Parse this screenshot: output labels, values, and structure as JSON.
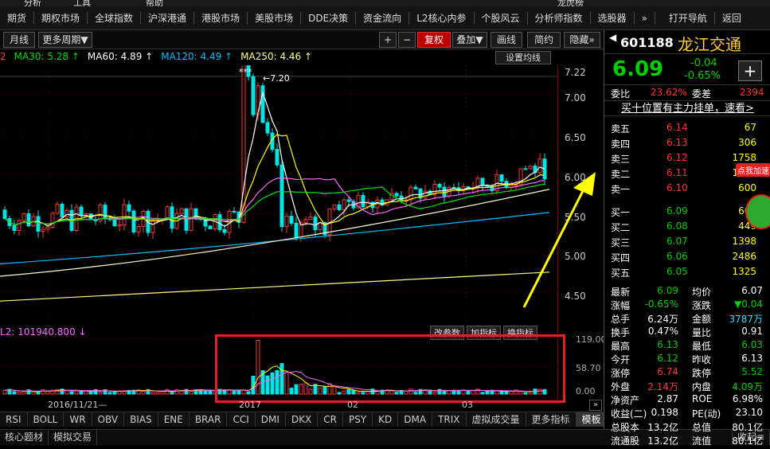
{
  "topbar": [
    "分析",
    "工具",
    "帮助",
    "龙虎榜"
  ],
  "menu": [
    "期货",
    "期权市场",
    "全球指数",
    "沪深港通",
    "港股市场",
    "美股市场",
    "DDE决策",
    "资金流向",
    "L2核心内参",
    "个股风云",
    "分析师指数",
    "选股器",
    "»",
    "打开导航",
    "返回"
  ],
  "toolbar": {
    "period_day": "月线",
    "more_period": "更多周期▼",
    "plus": "+",
    "minus": "−",
    "fuquan": "复权",
    "add": "叠加▼",
    "draw": "画线",
    "brief": "简约",
    "hide": "隐藏»",
    "set_ma": "设置均线"
  },
  "ma_legend": [
    {
      "text": "2",
      "color": "#ff3232"
    },
    {
      "text": "MA30: 5.28 ↑",
      "color": "#00e000"
    },
    {
      "text": "MA60: 4.89 ↑",
      "color": "#ffffff"
    },
    {
      "text": "MA120: 4.49 ↑",
      "color": "#00bfff"
    },
    {
      "text": "MA250: 4.46 ↑",
      "color": "#ffff80"
    }
  ],
  "price_axis": [
    "7.22",
    "7.00",
    "6.50",
    "6.00",
    "5.50",
    "5.00",
    "4.50"
  ],
  "peak_label": "7.20",
  "stars": "***",
  "vol_legend": "L2: 101940.800 ↓",
  "vol_axis": [
    "119.00",
    "58.70",
    "0.00"
  ],
  "vol_buttons": [
    "改参数",
    "加指标",
    "换指标"
  ],
  "dates": {
    "d1": "2016/11/21—",
    "d2": "2017",
    "d3": "02",
    "d4": "03"
  },
  "indicators": [
    "RSI",
    "BOLL",
    "WR",
    "OBV",
    "BIAS",
    "ENE",
    "BRAR",
    "CCI",
    "DMI",
    "DKX",
    "CR",
    "PSY",
    "KD",
    "DMA",
    "TRIX",
    "虚拟成交量",
    "更多指标",
    "模板"
  ],
  "bottom": [
    "核心题材",
    "模拟交易",
    "收起≡"
  ],
  "promo": "点我加速",
  "stock": {
    "code": "601188",
    "name": "龙江交通",
    "price": "6.09",
    "change": "-0.04",
    "change_pct": "-0.65%",
    "add_btn": "+",
    "weibi_label": "委比",
    "weibi": "23.62%",
    "weicha_label": "委差",
    "weicha": "2394",
    "banner": "买十位置有主力挂单，速看>"
  },
  "sell": [
    {
      "label": "卖五",
      "price": "6.14",
      "vol": "67"
    },
    {
      "label": "卖四",
      "price": "6.13",
      "vol": "306"
    },
    {
      "label": "卖三",
      "price": "6.12",
      "vol": "1758"
    },
    {
      "label": "卖二",
      "price": "6.11",
      "vol": "1138"
    },
    {
      "label": "卖一",
      "price": "6.10",
      "vol": "600"
    }
  ],
  "buy": [
    {
      "label": "买一",
      "price": "6.09",
      "vol": "604"
    },
    {
      "label": "买二",
      "price": "6.08",
      "vol": "449"
    },
    {
      "label": "买三",
      "price": "6.07",
      "vol": "1398"
    },
    {
      "label": "买四",
      "price": "6.06",
      "vol": "2486"
    },
    {
      "label": "买五",
      "price": "6.05",
      "vol": "1325"
    }
  ],
  "stats": [
    {
      "l1": "最新",
      "v1": "6.09",
      "c1": "green",
      "l2": "均价",
      "v2": "6.07",
      "c2": "white"
    },
    {
      "l1": "涨幅",
      "v1": "-0.65%",
      "c1": "green",
      "l2": "涨跌",
      "v2": "▼0.04",
      "c2": "green"
    },
    {
      "l1": "总手",
      "v1": "6.24万",
      "c1": "white",
      "l2": "金额",
      "v2": "3787万",
      "c2": "cyan"
    },
    {
      "l1": "换手",
      "v1": "0.47%",
      "c1": "white",
      "l2": "量比",
      "v2": "0.91",
      "c2": "white"
    },
    {
      "l1": "最高",
      "v1": "6.13",
      "c1": "green",
      "l2": "最低",
      "v2": "6.03",
      "c2": "green"
    },
    {
      "l1": "今开",
      "v1": "6.12",
      "c1": "green",
      "l2": "昨收",
      "v2": "6.13",
      "c2": "white"
    },
    {
      "l1": "涨停",
      "v1": "6.74",
      "c1": "red",
      "l2": "跌停",
      "v2": "5.52",
      "c2": "green"
    },
    {
      "l1": "外盘",
      "v1": "2.14万",
      "c1": "red",
      "l2": "内盘",
      "v2": "4.09万",
      "c2": "green"
    },
    {
      "l1": "净资产",
      "v1": "2.87",
      "c1": "white",
      "l2": "ROE",
      "v2": "6.98%",
      "c2": "white"
    },
    {
      "l1": "收益(二)",
      "v1": "0.198",
      "c1": "white",
      "l2": "PE(动)",
      "v2": "23.10",
      "c2": "white"
    },
    {
      "l1": "总股本",
      "v1": "13.2亿",
      "c1": "white",
      "l2": "总值",
      "v2": "80.1亿",
      "c2": "white"
    },
    {
      "l1": "流通股",
      "v1": "13.2亿",
      "c1": "white",
      "l2": "流值",
      "v2": "80.1亿",
      "c2": "white"
    }
  ]
}
